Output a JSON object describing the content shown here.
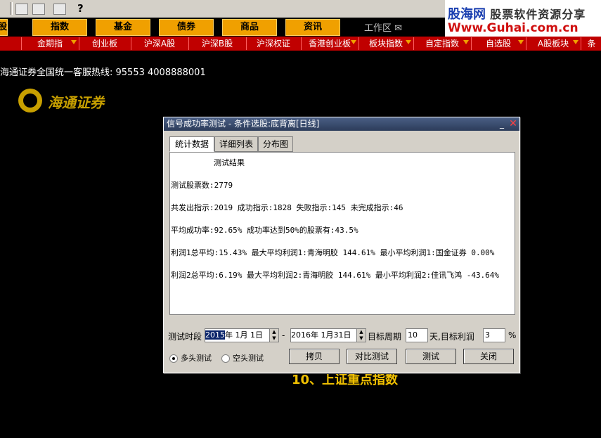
{
  "toolbar": {
    "icons": [
      "back-icon",
      "view-icon",
      "list-icon",
      "tools-icon",
      "help-pointer-icon"
    ]
  },
  "site_logo": {
    "line1": "股海网",
    "line1_sub": "股票软件资源分享",
    "line2": "Www.Guhai.com.cn"
  },
  "menu": {
    "items": [
      {
        "label": "股"
      },
      {
        "label": "指数"
      },
      {
        "label": "基金"
      },
      {
        "label": "债券"
      },
      {
        "label": "商品"
      },
      {
        "label": "资讯"
      }
    ],
    "workzone": "工作区"
  },
  "tabs": [
    {
      "label": "金期指"
    },
    {
      "label": "创业板"
    },
    {
      "label": "沪深A股"
    },
    {
      "label": "沪深B股"
    },
    {
      "label": "沪深权证"
    },
    {
      "label": "香港创业板"
    },
    {
      "label": "板块指数"
    },
    {
      "label": "自定指数"
    },
    {
      "label": "自选股"
    },
    {
      "label": "A股板块"
    },
    {
      "label": "条"
    }
  ],
  "hotline": "海通证券全国统一客服热线: 95553 4008888001",
  "brand": {
    "name": "海通证券"
  },
  "background_hint": "10、上证重点指数",
  "dialog": {
    "title": "信号成功率测试 - 条件选股:底背离[日线]",
    "tabs": [
      "统计数据",
      "详细列表",
      "分布图"
    ],
    "result_lines": [
      "测试结果",
      "测试股票数:2779",
      "共发出指示:2019 成功指示:1828 失败指示:145 未完成指示:46",
      "平均成功率:92.65% 成功率达到50%的股票有:43.5%",
      "利润1总平均:15.43% 最大平均利润1:青海明胶 144.61% 最小平均利润1:国金证券 0.00%",
      "利润2总平均:6.19% 最大平均利润2:青海明胶 144.61% 最小平均利润2:佳讯飞鸿 -43.64%"
    ],
    "period_label": "测试时段",
    "start_year": "2015",
    "start_rest": "年  1月 1日",
    "dash": "-",
    "end_date": "2016年  1月31日",
    "target_period_label": "目标周期",
    "target_period_value": "10",
    "target_profit_label": "天,目标利润",
    "target_profit_value": "3",
    "percent": "%",
    "radio_long": "多头测试",
    "radio_short": "空头测试",
    "buttons": {
      "copy": "拷贝",
      "compare": "对比测试",
      "test": "测试",
      "close": "关闭"
    }
  }
}
